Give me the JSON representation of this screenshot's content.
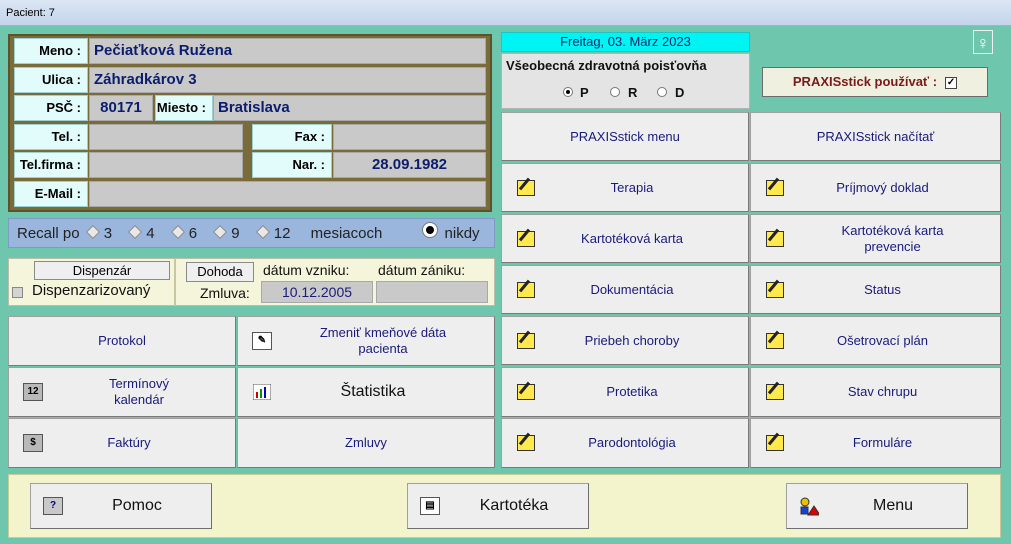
{
  "window": {
    "title": "Pacient: 7"
  },
  "patient": {
    "labels": {
      "name": "Meno :",
      "street": "Ulica :",
      "zip": "PSČ :",
      "city": "Miesto :",
      "phone": "Tel. :",
      "fax": "Fax :",
      "phone_company": "Tel.firma :",
      "birth": "Nar. :",
      "email": "E-Mail :"
    },
    "name": "Pečiaťková Ružena",
    "street": "Záhradkárov 3",
    "zip": "80171",
    "city": "Bratislava",
    "phone": "",
    "fax": "",
    "phone_company": "",
    "birth": "28.09.1982",
    "email": ""
  },
  "recall": {
    "label": "Recall po",
    "options": [
      "3",
      "4",
      "6",
      "9",
      "12"
    ],
    "unit": "mesiacoch",
    "never": "nikdy",
    "selected": "nikdy"
  },
  "dispensary": {
    "button": "Dispenzár",
    "checkbox_label": "Dispenzarizovaný",
    "agreement_button": "Dohoda",
    "created_label": "dátum vzniku:",
    "ended_label": "dátum zániku:",
    "contract_label": "Zmluva:",
    "created_value": "10.12.2005",
    "ended_value": ""
  },
  "left_buttons": {
    "protocol": "Protokol",
    "change_data": "Zmeniť kmeňové dáta pacienta",
    "calendar": "Termínový kalendár",
    "statistics": "Štatistika",
    "invoices": "Faktúry",
    "contracts": "Zmluvy"
  },
  "date": "Freitag, 03. März 2023",
  "insurance": {
    "title": "Všeobecná zdravotná poisťovňa",
    "options": [
      "P",
      "R",
      "D"
    ],
    "selected": "P"
  },
  "praxis": {
    "use_label": "PRAXISstick používať :",
    "use_checked": true
  },
  "female_symbol": "♀",
  "right_buttons": {
    "praxis_menu": "PRAXISstick menu",
    "praxis_load": "PRAXISstick načítať",
    "therapy": "Terapia",
    "receipt": "Príjmový doklad",
    "card": "Kartotéková karta",
    "card_prevention": "Kartotéková karta prevencie",
    "documentation": "Dokumentácia",
    "status": "Status",
    "disease_course": "Priebeh choroby",
    "treatment_plan": "Ošetrovací plán",
    "prosthetics": "Protetika",
    "teeth_state": "Stav chrupu",
    "periodontology": "Parodontológia",
    "forms": "Formuláre"
  },
  "bottom": {
    "help": "Pomoc",
    "cardfile": "Kartotéka",
    "menu": "Menu"
  }
}
